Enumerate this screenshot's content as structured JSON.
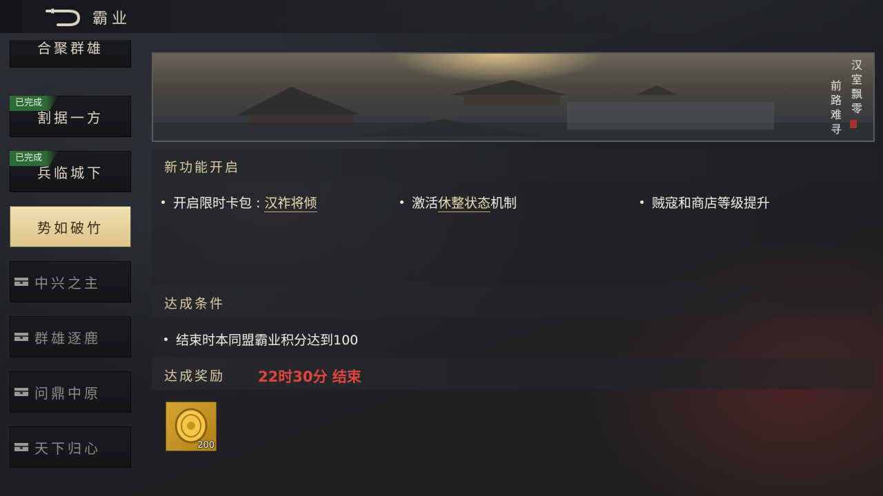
{
  "header": {
    "title": "霸业"
  },
  "sidebar": {
    "items": [
      {
        "label": "合聚群雄",
        "status": ""
      },
      {
        "label": "割据一方",
        "status": "已完成"
      },
      {
        "label": "兵临城下",
        "status": "已完成"
      },
      {
        "label": "势如破竹",
        "status": "active"
      },
      {
        "label": "中兴之主",
        "status": "locked"
      },
      {
        "label": "群雄逐鹿",
        "status": "locked"
      },
      {
        "label": "问鼎中原",
        "status": "locked"
      },
      {
        "label": "天下归心",
        "status": "locked"
      }
    ],
    "done_label": "已完成"
  },
  "banner": {
    "poem_col1": "汉室飘零",
    "poem_col2": "前路难寻"
  },
  "features": {
    "title": "新功能开启",
    "item1_prefix": "开启限时卡包 : ",
    "item1_link": "汉祚将倾",
    "item2_prefix": "激活",
    "item2_link": "休整状态",
    "item2_suffix": "机制",
    "item3": "贼寇和商店等级提升"
  },
  "conditions": {
    "title": "达成条件",
    "item1": "结束时本同盟霸业积分达到100"
  },
  "rewards": {
    "title": "达成奖励",
    "timer": "22时30分 结束",
    "items": [
      {
        "name": "gold-coin",
        "count": "200"
      }
    ]
  },
  "colors": {
    "accent_gold": "#d8cba4",
    "timer_red": "#e0463f",
    "done_green": "#2f6b36",
    "active_tab": "#e6d29d"
  }
}
